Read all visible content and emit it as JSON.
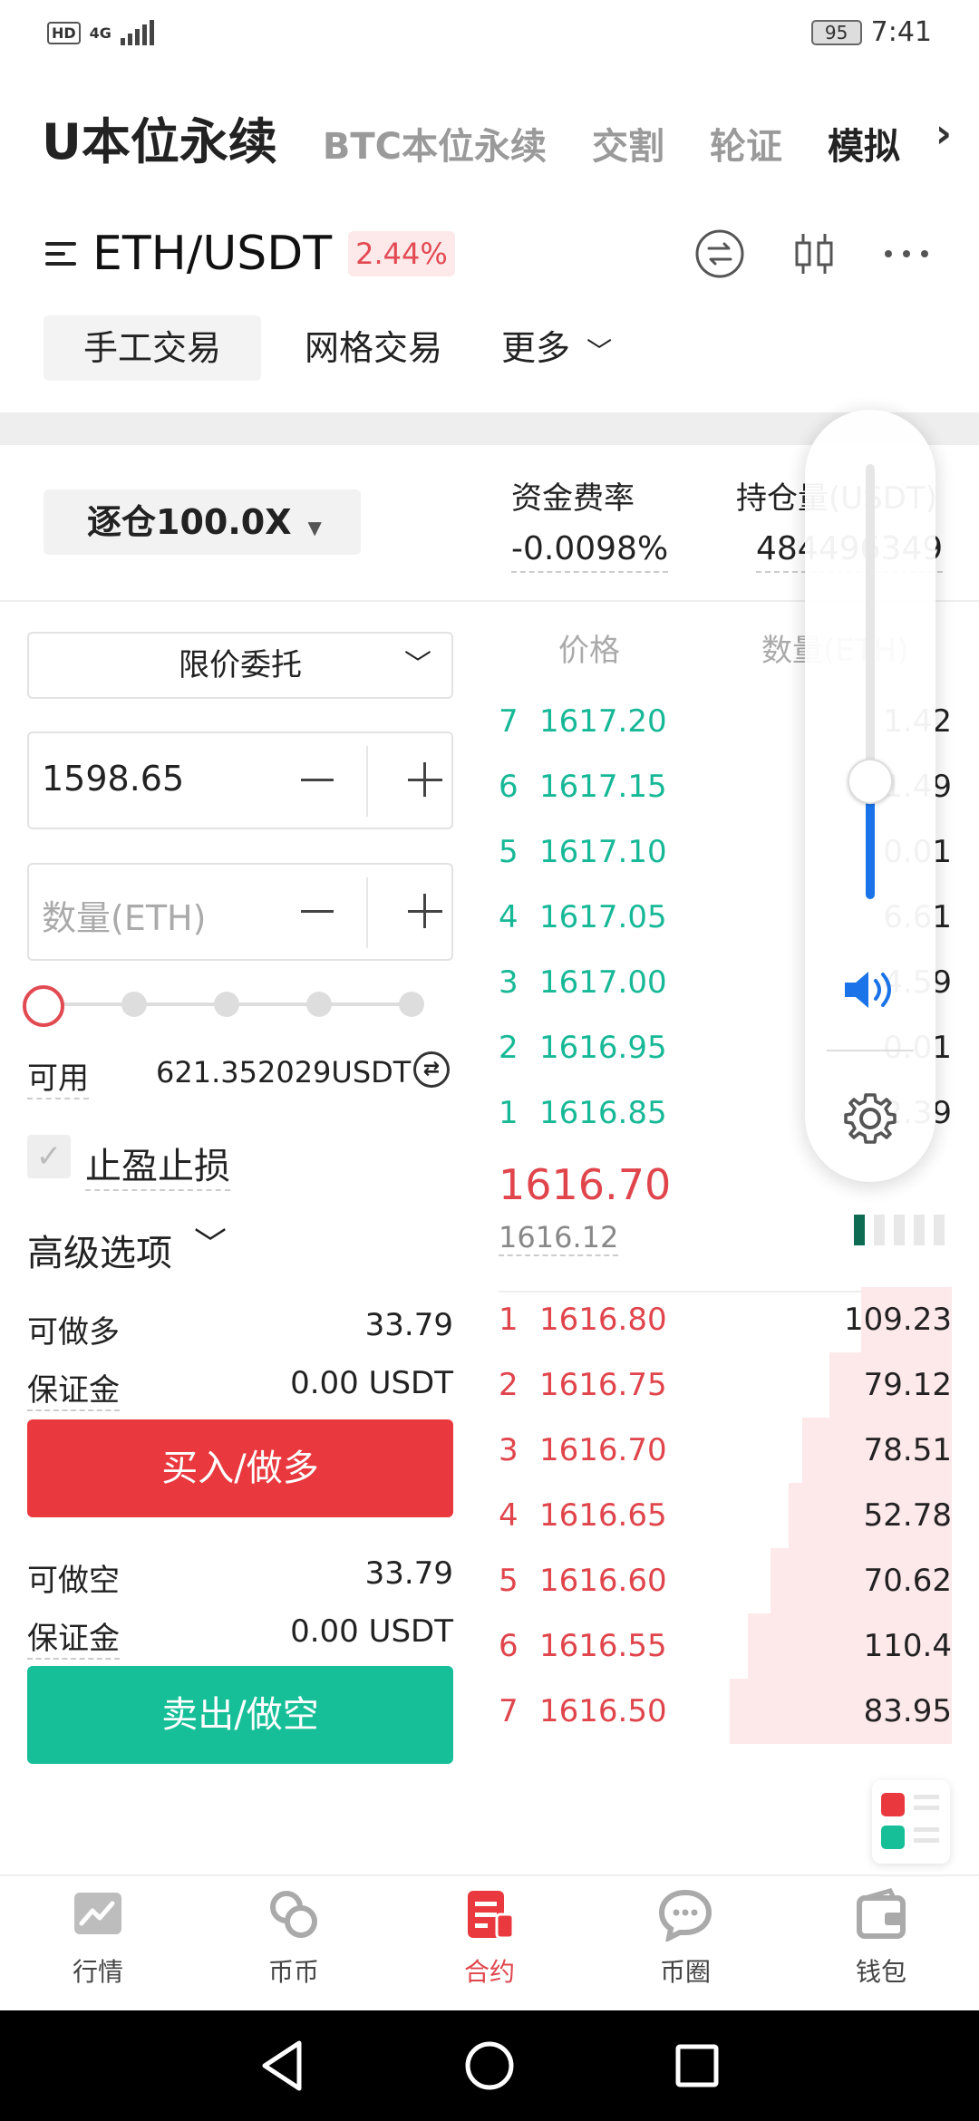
{
  "status_bar": {
    "hd": "HD",
    "network": "4G",
    "battery": "95",
    "time": "7:41"
  },
  "top_tabs": [
    "U本位永续",
    "BTC本位永续",
    "交割",
    "轮证",
    "模拟"
  ],
  "pair": {
    "name": "ETH/USDT",
    "change": "2.44%"
  },
  "mode_tabs": [
    "手工交易",
    "网格交易",
    "更多"
  ],
  "leverage": "逐仓100.0X",
  "funding": {
    "label": "资金费率",
    "value": "-0.0098%"
  },
  "position": {
    "label": "持仓量(USDT)",
    "value": "484496349"
  },
  "order_form": {
    "order_type": "限价委托",
    "price_value": "1598.65",
    "quantity_placeholder": "数量(ETH)",
    "available_label": "可用",
    "available_value": "621.352029USDT",
    "tpsl_label": "止盈止损",
    "advanced_label": "高级选项",
    "long": {
      "max_label": "可做多",
      "max_value": "33.79",
      "margin_label": "保证金",
      "margin_value": "0.00 USDT",
      "button": "买入/做多"
    },
    "short": {
      "max_label": "可做空",
      "max_value": "33.79",
      "margin_label": "保证金",
      "margin_value": "0.00 USDT",
      "button": "卖出/做空"
    }
  },
  "orderbook": {
    "price_header": "价格",
    "qty_header": "数量(ETH)",
    "asks": [
      {
        "idx": "7",
        "price": "1617.20",
        "qty": "1.42"
      },
      {
        "idx": "6",
        "price": "1617.15",
        "qty": "1.49"
      },
      {
        "idx": "5",
        "price": "1617.10",
        "qty": "0.01"
      },
      {
        "idx": "4",
        "price": "1617.05",
        "qty": "6.61"
      },
      {
        "idx": "3",
        "price": "1617.00",
        "qty": "4.59"
      },
      {
        "idx": "2",
        "price": "1616.95",
        "qty": "0.01"
      },
      {
        "idx": "1",
        "price": "1616.85",
        "qty": "2.39"
      }
    ],
    "last_price": "1616.70",
    "mark_price": "1616.12",
    "bids": [
      {
        "idx": "1",
        "price": "1616.80",
        "qty": "109.23",
        "depth": 0.2
      },
      {
        "idx": "2",
        "price": "1616.75",
        "qty": "79.12",
        "depth": 0.27
      },
      {
        "idx": "3",
        "price": "1616.70",
        "qty": "78.51",
        "depth": 0.33
      },
      {
        "idx": "4",
        "price": "1616.65",
        "qty": "52.78",
        "depth": 0.36
      },
      {
        "idx": "5",
        "price": "1616.60",
        "qty": "70.62",
        "depth": 0.4
      },
      {
        "idx": "6",
        "price": "1616.55",
        "qty": "110.4",
        "depth": 0.45
      },
      {
        "idx": "7",
        "price": "1616.50",
        "qty": "83.95",
        "depth": 0.49
      }
    ]
  },
  "volume_overlay": {
    "level": 0.27,
    "icons": [
      "speaker-icon",
      "gear-icon"
    ]
  },
  "bottom_nav": [
    {
      "label": "行情",
      "icon": "chart-icon"
    },
    {
      "label": "币币",
      "icon": "coin-swap-icon"
    },
    {
      "label": "合约",
      "icon": "contract-icon",
      "active": true
    },
    {
      "label": "币圈",
      "icon": "chat-icon"
    },
    {
      "label": "钱包",
      "icon": "wallet-icon"
    }
  ],
  "colors": {
    "red": "#e9393f",
    "green": "#16bf98",
    "accent_blue": "#1a73e8"
  }
}
